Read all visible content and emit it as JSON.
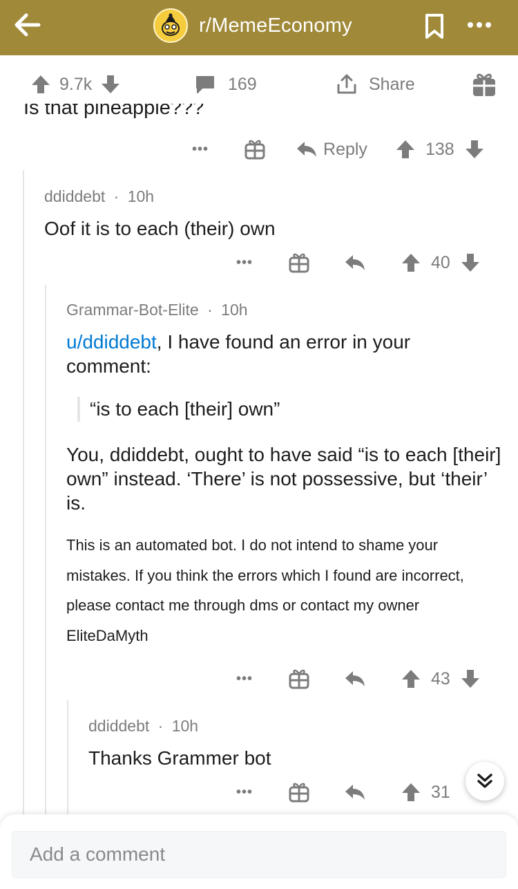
{
  "header": {
    "subreddit": "r/MemeEconomy",
    "icons": [
      "back-arrow-icon",
      "subreddit-avatar-icon",
      "bookmark-icon",
      "more-icon"
    ]
  },
  "post_bar": {
    "score": "9.7k",
    "comments": "169",
    "share_label": "Share"
  },
  "partial_comment": {
    "text": "Is that pineapple???",
    "reply_label": "Reply",
    "score": "138"
  },
  "comments": [
    {
      "author": "ddiddebt",
      "age": "10h",
      "body": "Oof it is to each (their) own",
      "score": "40"
    },
    {
      "author": "Grammar-Bot-Elite",
      "age": "10h",
      "mention": "u/ddiddebt",
      "intro": ", I have found an error in your comment:",
      "quote": "“is to each [their] own”",
      "correction": "You, ddiddebt, ought to have said “is to each [their] own” instead. ‘There’ is not possessive, but ‘their’ is.",
      "footer": "This is an automated bot. I do not intend to shame your mistakes. If you think the errors which I found are incorrect, please contact me through dms or contact my owner EliteDaMyth",
      "score": "43"
    },
    {
      "author": "ddiddebt",
      "age": "10h",
      "body": "Thanks Grammer bot",
      "score": "31"
    }
  ],
  "separator": "·",
  "composer": {
    "placeholder": "Add a comment"
  },
  "colors": {
    "header_bg": "#a08a3a",
    "link": "#0079d3",
    "muted": "#7c7c7c"
  }
}
